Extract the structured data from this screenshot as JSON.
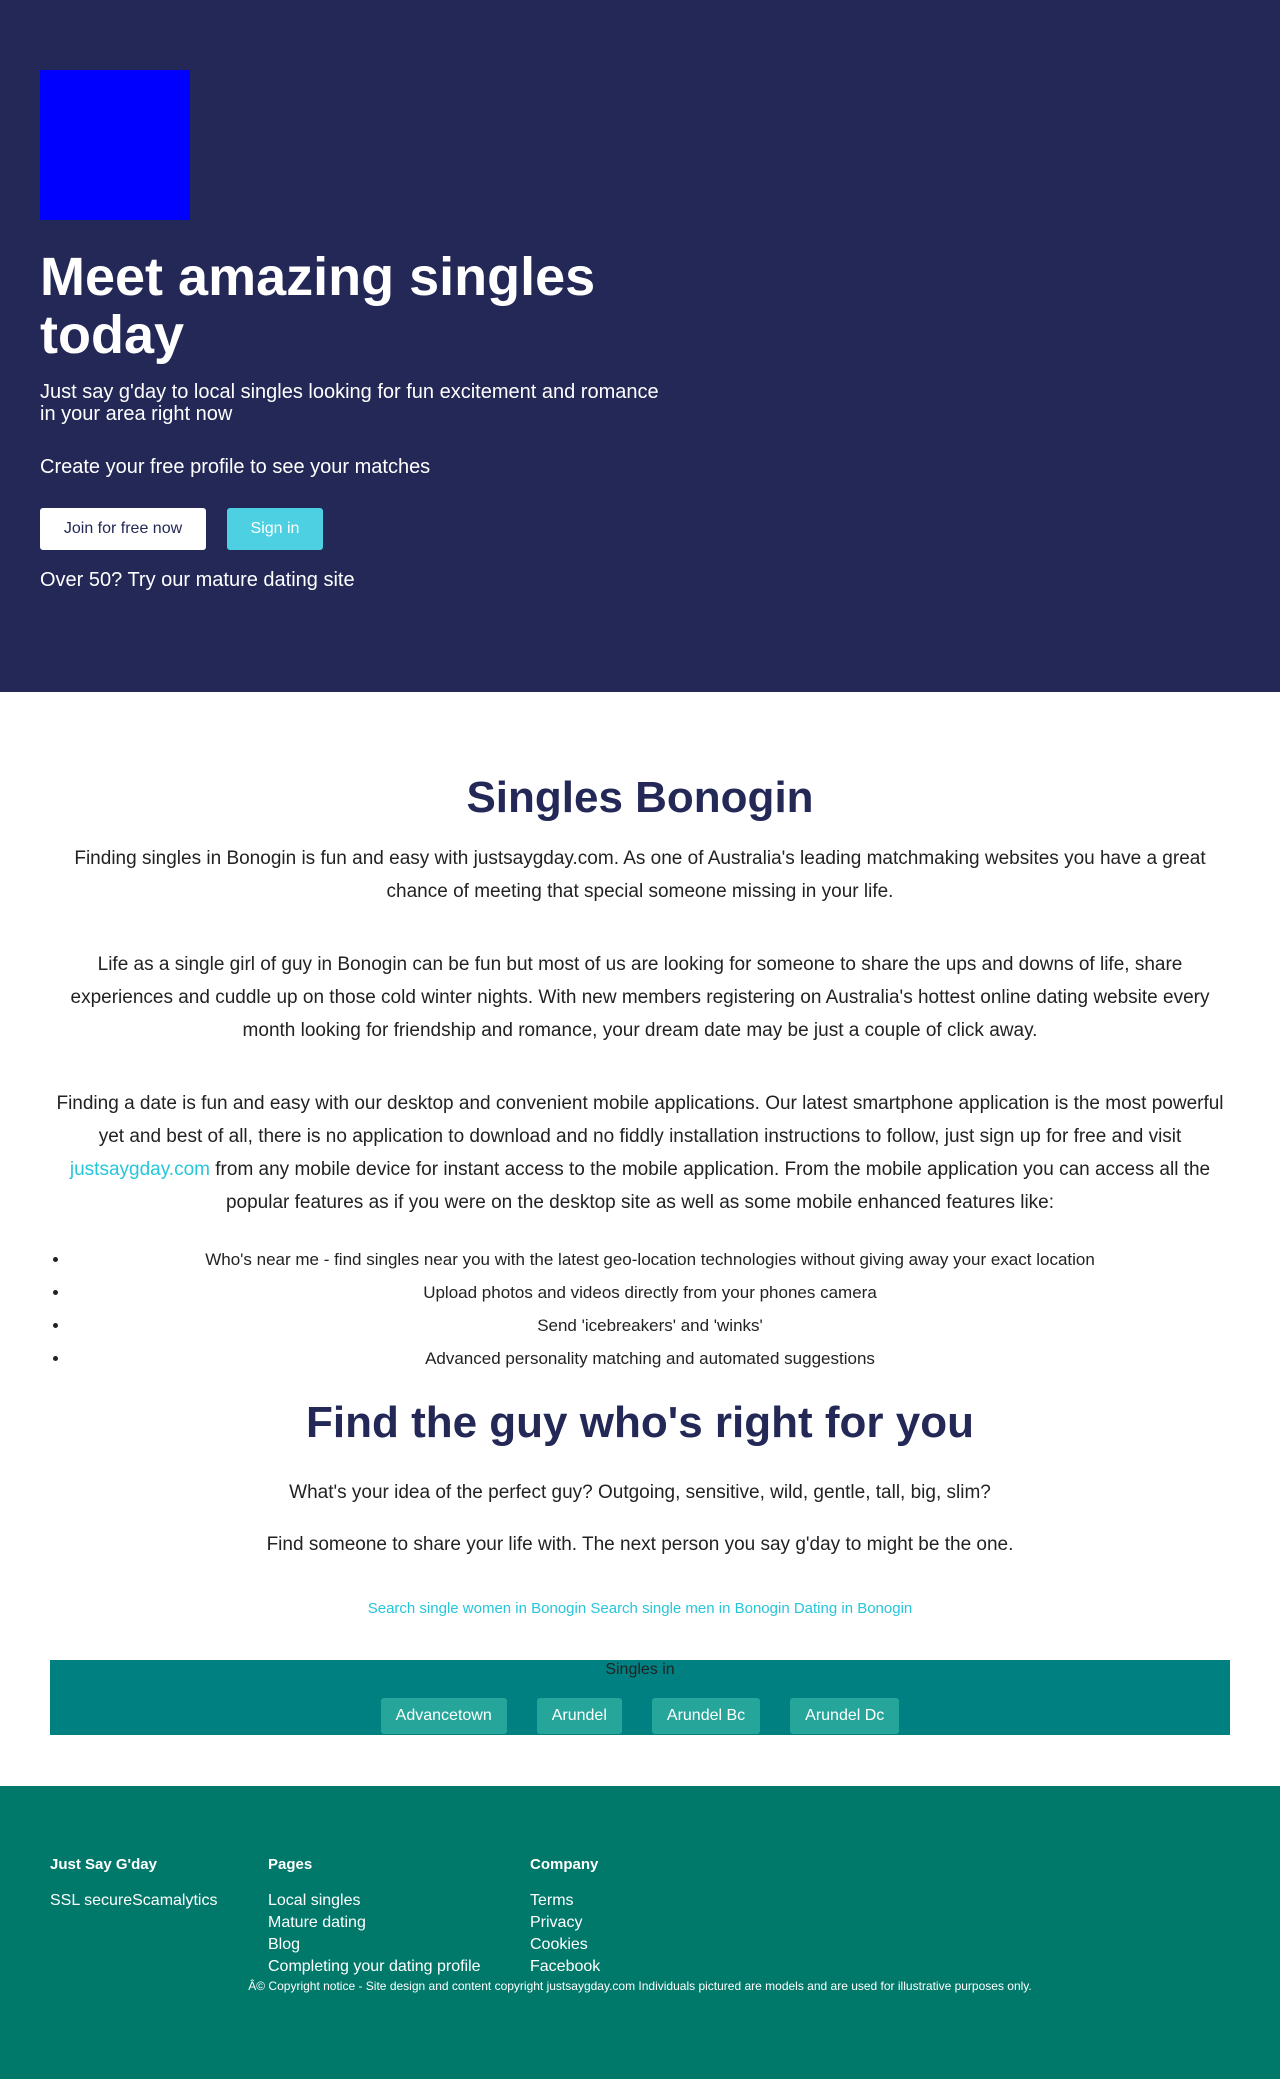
{
  "hero": {
    "title": "Meet amazing singles today",
    "subtitle": "Just say g'day to local singles looking for fun excitement and romance in your area right now",
    "cta_text": "Create your free profile to see your matches",
    "join_button": "Join for free now",
    "signin_button": "Sign in",
    "mature_link": "Over 50? Try our mature dating site",
    "logo_color": "#0000ff",
    "background_color": "#232856"
  },
  "main": {
    "heading": "Singles Bonogin",
    "para1": "Finding singles in Bonogin is fun and easy with justsaygday.com. As one of Australia's leading matchmaking websites you have a great chance of meeting that special someone missing in your life.",
    "para2": "Life as a single girl of guy in Bonogin can be fun but most of us are looking for someone to share the ups and downs of life, share experiences and cuddle up on those cold winter nights. With new members registering on Australia's hottest online dating website every month looking for friendship and romance, your dream date may be just a couple of click away.",
    "para3_before": "Finding a date is fun and easy with our desktop and convenient mobile applications. Our latest smartphone application is the most powerful yet and best of all, there is no application to download and no fiddly installation instructions to follow, just sign up for free and visit",
    "para3_link": "justsaygday.com",
    "para3_after": "from any mobile device for instant access to the mobile application. From the mobile application you can access all the popular features as if you were on the desktop site as well as some mobile enhanced features like:",
    "features": [
      "Who's near me - find singles near you with the latest geo-location technologies without giving away your exact location",
      "Upload photos and videos directly from your phones camera",
      "Send 'icebreakers' and 'winks'",
      "Advanced personality matching and automated suggestions"
    ],
    "heading2": "Find the guy who's right for you",
    "question1": "What's your idea of the perfect guy? Outgoing, sensitive, wild, gentle, tall, big, slim?",
    "question2": "Find someone to share your life with. The next person you say g'day to might be the one.",
    "search_links": [
      "Search single women in Bonogin",
      "Search single men in Bonogin",
      "Dating in Bonogin"
    ],
    "link_color": "#26c6da",
    "heading_color": "#232856"
  },
  "singles_in": {
    "label": "Singles in",
    "towns": [
      "Advancetown",
      "Arundel",
      "Arundel Bc",
      "Arundel Dc"
    ],
    "box_color": "#008080",
    "button_color": "#26a69a"
  },
  "footer": {
    "background_color": "#00796b",
    "col1": {
      "title": "Just Say G'day",
      "items": [
        "SSL secureScamalytics"
      ]
    },
    "col2": {
      "title": "Pages",
      "items": [
        "Local singles",
        "Mature dating",
        "Blog",
        "Completing your dating profile"
      ]
    },
    "col3": {
      "title": "Company",
      "items": [
        "Terms",
        "Privacy",
        "Cookies",
        "Facebook"
      ]
    },
    "copyright": "Â© Copyright notice - Site design and content copyright justsaygday.com Individuals pictured are models and are used for illustrative purposes only."
  }
}
